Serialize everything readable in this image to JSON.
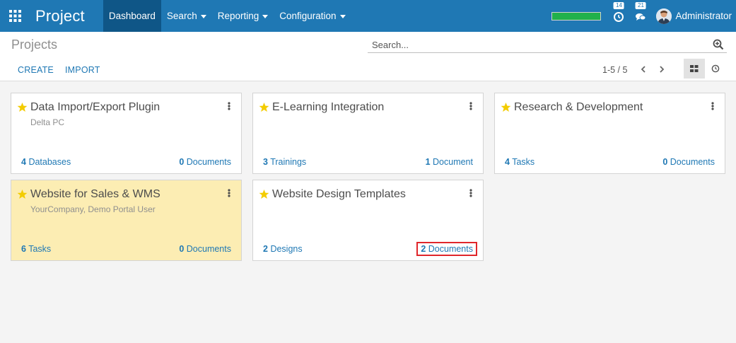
{
  "navbar": {
    "app_title": "Project",
    "menu": [
      {
        "label": "Dashboard",
        "active": true
      },
      {
        "label": "Search",
        "dropdown": true
      },
      {
        "label": "Reporting",
        "dropdown": true
      },
      {
        "label": "Configuration",
        "dropdown": true
      }
    ],
    "progress_fraction": 1.0,
    "activity_badge": "14",
    "messages_badge": "21",
    "user_name": "Administrator",
    "colors": {
      "bar": "#1f78b4",
      "active": "#0f5687"
    }
  },
  "control_panel": {
    "title": "Projects",
    "search_placeholder": "Search...",
    "create_label": "CREATE",
    "import_label": "IMPORT",
    "pager": "1-5 / 5"
  },
  "projects": [
    {
      "title": "Data Import/Export Plugin",
      "subtitle": "Delta PC",
      "favorite": true,
      "left_count": "4",
      "left_label": "Databases",
      "right_count": "0",
      "right_label": "Documents"
    },
    {
      "title": "E-Learning Integration",
      "subtitle": "",
      "favorite": true,
      "left_count": "3",
      "left_label": "Trainings",
      "right_count": "1",
      "right_label": "Document"
    },
    {
      "title": "Research & Development",
      "subtitle": "",
      "favorite": true,
      "left_count": "4",
      "left_label": "Tasks",
      "right_count": "0",
      "right_label": "Documents"
    },
    {
      "title": "Website for Sales & WMS",
      "subtitle": "YourCompany, Demo Portal User",
      "favorite": true,
      "highlighted": true,
      "left_count": "6",
      "left_label": "Tasks",
      "right_count": "0",
      "right_label": "Documents"
    },
    {
      "title": "Website Design Templates",
      "subtitle": "",
      "favorite": true,
      "left_count": "2",
      "left_label": "Designs",
      "right_count": "2",
      "right_label": "Documents",
      "right_boxed": true
    }
  ],
  "icons": [
    "apps-grid-icon",
    "caret-down-icon",
    "clock-icon",
    "chat-icon",
    "user-avatar",
    "search-zoom-icon",
    "chevron-left-icon",
    "chevron-right-icon",
    "kanban-view-icon",
    "activity-view-icon",
    "star-icon",
    "kebab-menu-icon"
  ],
  "accent_colors": {
    "link": "#1f78b4",
    "star": "#f3cc00",
    "highlight_card": "#fcedb3",
    "boxed_outline": "#e0262b"
  }
}
